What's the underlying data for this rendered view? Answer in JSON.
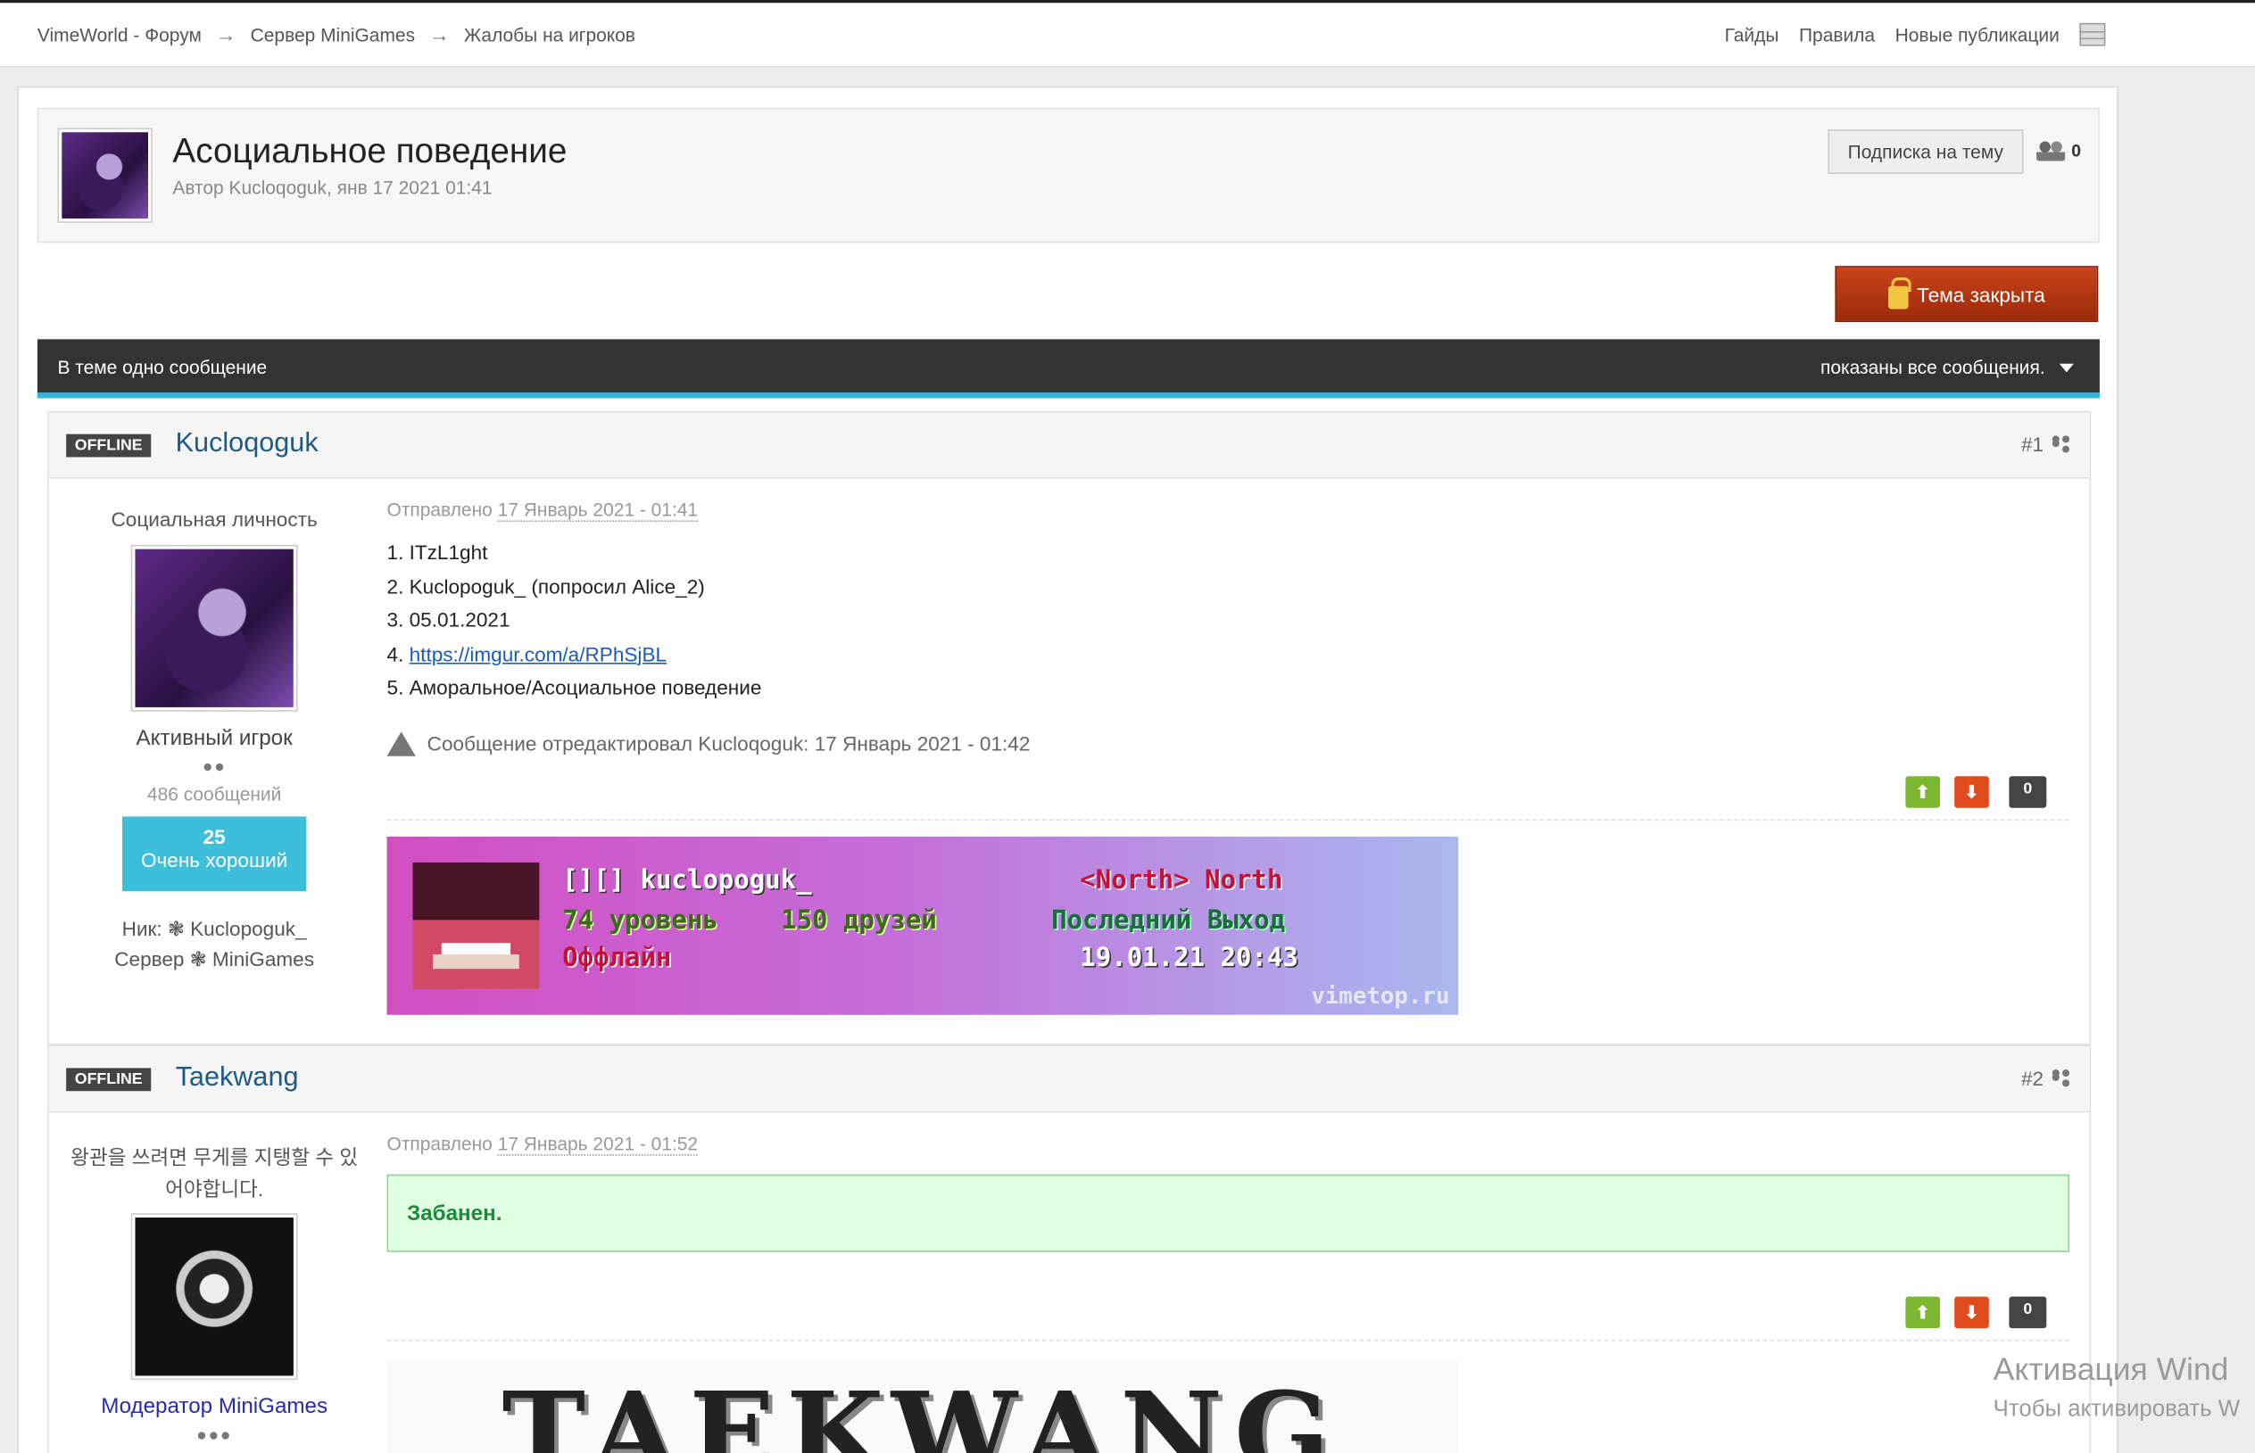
{
  "breadcrumbs": [
    "VimeWorld - Форум",
    "Сервер MiniGames",
    "Жалобы на игроков"
  ],
  "breadcrumb_separator": "→",
  "topnav": [
    "Гайды",
    "Правила",
    "Новые публикации"
  ],
  "topic": {
    "title": "Асоциальное поведение",
    "meta": "Автор Kucloqoguk, янв 17 2021 01:41",
    "subscribe_label": "Подписка на тему",
    "followers": "0",
    "closed_label": "Тема закрыта"
  },
  "bar": {
    "left": "В теме одно сообщение",
    "right": "показаны все сообщения."
  },
  "posts": [
    {
      "status": "OFFLINE",
      "author": "Kucloqoguk",
      "num": "#1",
      "user_title": "Социальная личность",
      "rank": "Активный игрок",
      "rank_pips": "●●",
      "messages": "486 сообщений",
      "rep_value": "25",
      "rep_label": "Очень хороший",
      "nick": "Ник: ❃ Kuclopoguk_",
      "server": "Сервер ❃ MiniGames",
      "posted_label": "Отправлено",
      "posted_date": "17 Январь 2021 - 01:41",
      "lines": [
        "1. ITzL1ght",
        "2. Kuclopoguk_ (попросил Alice_2)",
        "3. 05.01.2021",
        "4. ",
        "5. Аморальное/Асоциальное поведение"
      ],
      "link": "https://imgur.com/a/RPhSjBL",
      "edit_note": "Сообщение отредактировал Kucloqoguk: 17 Январь 2021 - 01:42",
      "votes": "0",
      "banner": {
        "name": "[][] kuclopoguk_",
        "level": "74 уровень",
        "friends": "150 друзей",
        "status": "Оффлайн",
        "guild": "<North> North",
        "last_label": "Последний Выход",
        "last_date": "19.01.21 20:43",
        "site": "vimetop.ru"
      }
    },
    {
      "status": "OFFLINE",
      "author": "Taekwang",
      "num": "#2",
      "user_title": "왕관을 쓰려면 무게를 지탱할 수 있어야합니다.",
      "rank": "Модератор MiniGames",
      "rank_pips": "●●●",
      "posted_label": "Отправлено",
      "posted_date": "17 Январь 2021 - 01:52",
      "message": "Забанен.",
      "votes": "0",
      "signature_text": "TAEKWANG"
    }
  ],
  "watermark": {
    "line1": "Активация Wind",
    "line2": "Чтобы активировать W"
  },
  "colors": {
    "accent_blue": "#39b3d7",
    "closed_red": "#b8361a",
    "rep_cyan": "#3dbfd9",
    "ban_green": "#1f8a3d"
  }
}
